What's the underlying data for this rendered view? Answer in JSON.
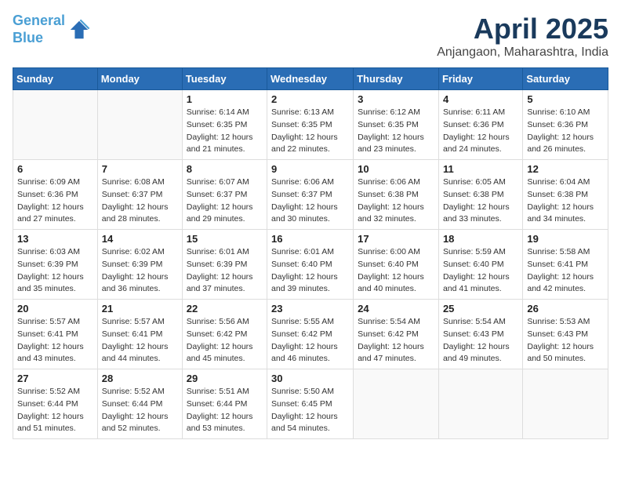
{
  "logo": {
    "line1": "General",
    "line2": "Blue"
  },
  "title": "April 2025",
  "subtitle": "Anjangaon, Maharashtra, India",
  "weekdays": [
    "Sunday",
    "Monday",
    "Tuesday",
    "Wednesday",
    "Thursday",
    "Friday",
    "Saturday"
  ],
  "weeks": [
    [
      {
        "day": "",
        "info": ""
      },
      {
        "day": "",
        "info": ""
      },
      {
        "day": "1",
        "info": "Sunrise: 6:14 AM\nSunset: 6:35 PM\nDaylight: 12 hours and 21 minutes."
      },
      {
        "day": "2",
        "info": "Sunrise: 6:13 AM\nSunset: 6:35 PM\nDaylight: 12 hours and 22 minutes."
      },
      {
        "day": "3",
        "info": "Sunrise: 6:12 AM\nSunset: 6:35 PM\nDaylight: 12 hours and 23 minutes."
      },
      {
        "day": "4",
        "info": "Sunrise: 6:11 AM\nSunset: 6:36 PM\nDaylight: 12 hours and 24 minutes."
      },
      {
        "day": "5",
        "info": "Sunrise: 6:10 AM\nSunset: 6:36 PM\nDaylight: 12 hours and 26 minutes."
      }
    ],
    [
      {
        "day": "6",
        "info": "Sunrise: 6:09 AM\nSunset: 6:36 PM\nDaylight: 12 hours and 27 minutes."
      },
      {
        "day": "7",
        "info": "Sunrise: 6:08 AM\nSunset: 6:37 PM\nDaylight: 12 hours and 28 minutes."
      },
      {
        "day": "8",
        "info": "Sunrise: 6:07 AM\nSunset: 6:37 PM\nDaylight: 12 hours and 29 minutes."
      },
      {
        "day": "9",
        "info": "Sunrise: 6:06 AM\nSunset: 6:37 PM\nDaylight: 12 hours and 30 minutes."
      },
      {
        "day": "10",
        "info": "Sunrise: 6:06 AM\nSunset: 6:38 PM\nDaylight: 12 hours and 32 minutes."
      },
      {
        "day": "11",
        "info": "Sunrise: 6:05 AM\nSunset: 6:38 PM\nDaylight: 12 hours and 33 minutes."
      },
      {
        "day": "12",
        "info": "Sunrise: 6:04 AM\nSunset: 6:38 PM\nDaylight: 12 hours and 34 minutes."
      }
    ],
    [
      {
        "day": "13",
        "info": "Sunrise: 6:03 AM\nSunset: 6:39 PM\nDaylight: 12 hours and 35 minutes."
      },
      {
        "day": "14",
        "info": "Sunrise: 6:02 AM\nSunset: 6:39 PM\nDaylight: 12 hours and 36 minutes."
      },
      {
        "day": "15",
        "info": "Sunrise: 6:01 AM\nSunset: 6:39 PM\nDaylight: 12 hours and 37 minutes."
      },
      {
        "day": "16",
        "info": "Sunrise: 6:01 AM\nSunset: 6:40 PM\nDaylight: 12 hours and 39 minutes."
      },
      {
        "day": "17",
        "info": "Sunrise: 6:00 AM\nSunset: 6:40 PM\nDaylight: 12 hours and 40 minutes."
      },
      {
        "day": "18",
        "info": "Sunrise: 5:59 AM\nSunset: 6:40 PM\nDaylight: 12 hours and 41 minutes."
      },
      {
        "day": "19",
        "info": "Sunrise: 5:58 AM\nSunset: 6:41 PM\nDaylight: 12 hours and 42 minutes."
      }
    ],
    [
      {
        "day": "20",
        "info": "Sunrise: 5:57 AM\nSunset: 6:41 PM\nDaylight: 12 hours and 43 minutes."
      },
      {
        "day": "21",
        "info": "Sunrise: 5:57 AM\nSunset: 6:41 PM\nDaylight: 12 hours and 44 minutes."
      },
      {
        "day": "22",
        "info": "Sunrise: 5:56 AM\nSunset: 6:42 PM\nDaylight: 12 hours and 45 minutes."
      },
      {
        "day": "23",
        "info": "Sunrise: 5:55 AM\nSunset: 6:42 PM\nDaylight: 12 hours and 46 minutes."
      },
      {
        "day": "24",
        "info": "Sunrise: 5:54 AM\nSunset: 6:42 PM\nDaylight: 12 hours and 47 minutes."
      },
      {
        "day": "25",
        "info": "Sunrise: 5:54 AM\nSunset: 6:43 PM\nDaylight: 12 hours and 49 minutes."
      },
      {
        "day": "26",
        "info": "Sunrise: 5:53 AM\nSunset: 6:43 PM\nDaylight: 12 hours and 50 minutes."
      }
    ],
    [
      {
        "day": "27",
        "info": "Sunrise: 5:52 AM\nSunset: 6:44 PM\nDaylight: 12 hours and 51 minutes."
      },
      {
        "day": "28",
        "info": "Sunrise: 5:52 AM\nSunset: 6:44 PM\nDaylight: 12 hours and 52 minutes."
      },
      {
        "day": "29",
        "info": "Sunrise: 5:51 AM\nSunset: 6:44 PM\nDaylight: 12 hours and 53 minutes."
      },
      {
        "day": "30",
        "info": "Sunrise: 5:50 AM\nSunset: 6:45 PM\nDaylight: 12 hours and 54 minutes."
      },
      {
        "day": "",
        "info": ""
      },
      {
        "day": "",
        "info": ""
      },
      {
        "day": "",
        "info": ""
      }
    ]
  ]
}
